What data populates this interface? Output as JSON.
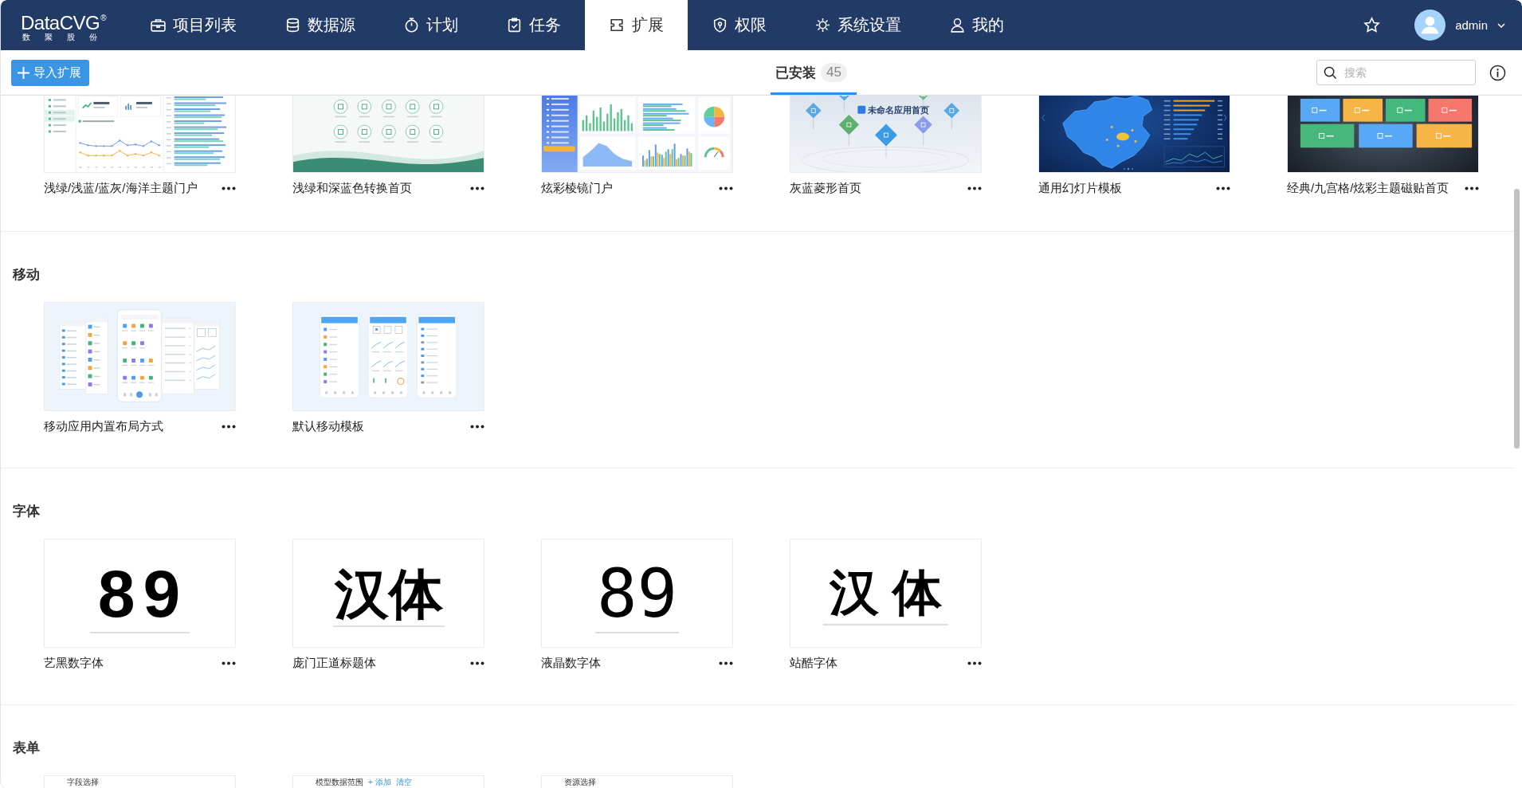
{
  "nav": {
    "logo": {
      "text": "DataCVG$^{®}$",
      "subtitle": "数聚股份"
    },
    "items": [
      {
        "label": "项目列表",
        "selected": false
      },
      {
        "label": "数据源",
        "selected": false
      },
      {
        "label": "计划",
        "selected": false
      },
      {
        "label": "任务",
        "selected": false
      },
      {
        "label": "扩展",
        "selected": true
      },
      {
        "label": "权限",
        "selected": false
      },
      {
        "label": "系统设置",
        "selected": false
      },
      {
        "label": "我的",
        "selected": false
      }
    ],
    "user": {
      "name": "admin"
    }
  },
  "toolbar": {
    "import_button": "导入扩展",
    "tabs": [
      {
        "label": "已安装",
        "count": "45",
        "selected": true
      }
    ],
    "search": {
      "placeholder": "搜索"
    }
  },
  "sections": [
    {
      "cards": [
        {
          "title": "浅绿/浅蓝/蓝灰/海洋主题门户",
          "kind": "portal"
        },
        {
          "title": "浅绿和深蓝色转换首页",
          "kind": "wave"
        },
        {
          "title": "炫彩棱镜门户",
          "kind": "prism"
        },
        {
          "title": "灰蓝菱形首页",
          "kind": "diamond",
          "preview_title": "未命名应用首页"
        },
        {
          "title": "通用幻灯片模板",
          "kind": "slides"
        },
        {
          "title": "经典/九宫格/炫彩主题磁贴首页",
          "kind": "tiles"
        }
      ]
    },
    {
      "heading": "移动",
      "cards": [
        {
          "title": "移动应用内置布局方式",
          "kind": "mobile-layouts"
        },
        {
          "title": "默认移动模板",
          "kind": "mobile-default"
        }
      ]
    },
    {
      "heading": "字体",
      "cards": [
        {
          "title": "艺黑数字体",
          "kind": "font",
          "sample": "89"
        },
        {
          "title": "庞门正道标题体",
          "kind": "font",
          "sample": "汉体"
        },
        {
          "title": "液晶数字体",
          "kind": "font",
          "sample": "89"
        },
        {
          "title": "站酷字体",
          "kind": "font",
          "sample": "汉 体"
        }
      ]
    },
    {
      "heading": "表单",
      "cards": [
        {
          "kind": "form",
          "preview_title": "字段选择"
        },
        {
          "kind": "form",
          "preview_title": "模型数据范围",
          "preview_actions": [
            "+ 添加",
            "清空"
          ]
        },
        {
          "kind": "form",
          "preview_title": "资源选择"
        }
      ]
    }
  ]
}
